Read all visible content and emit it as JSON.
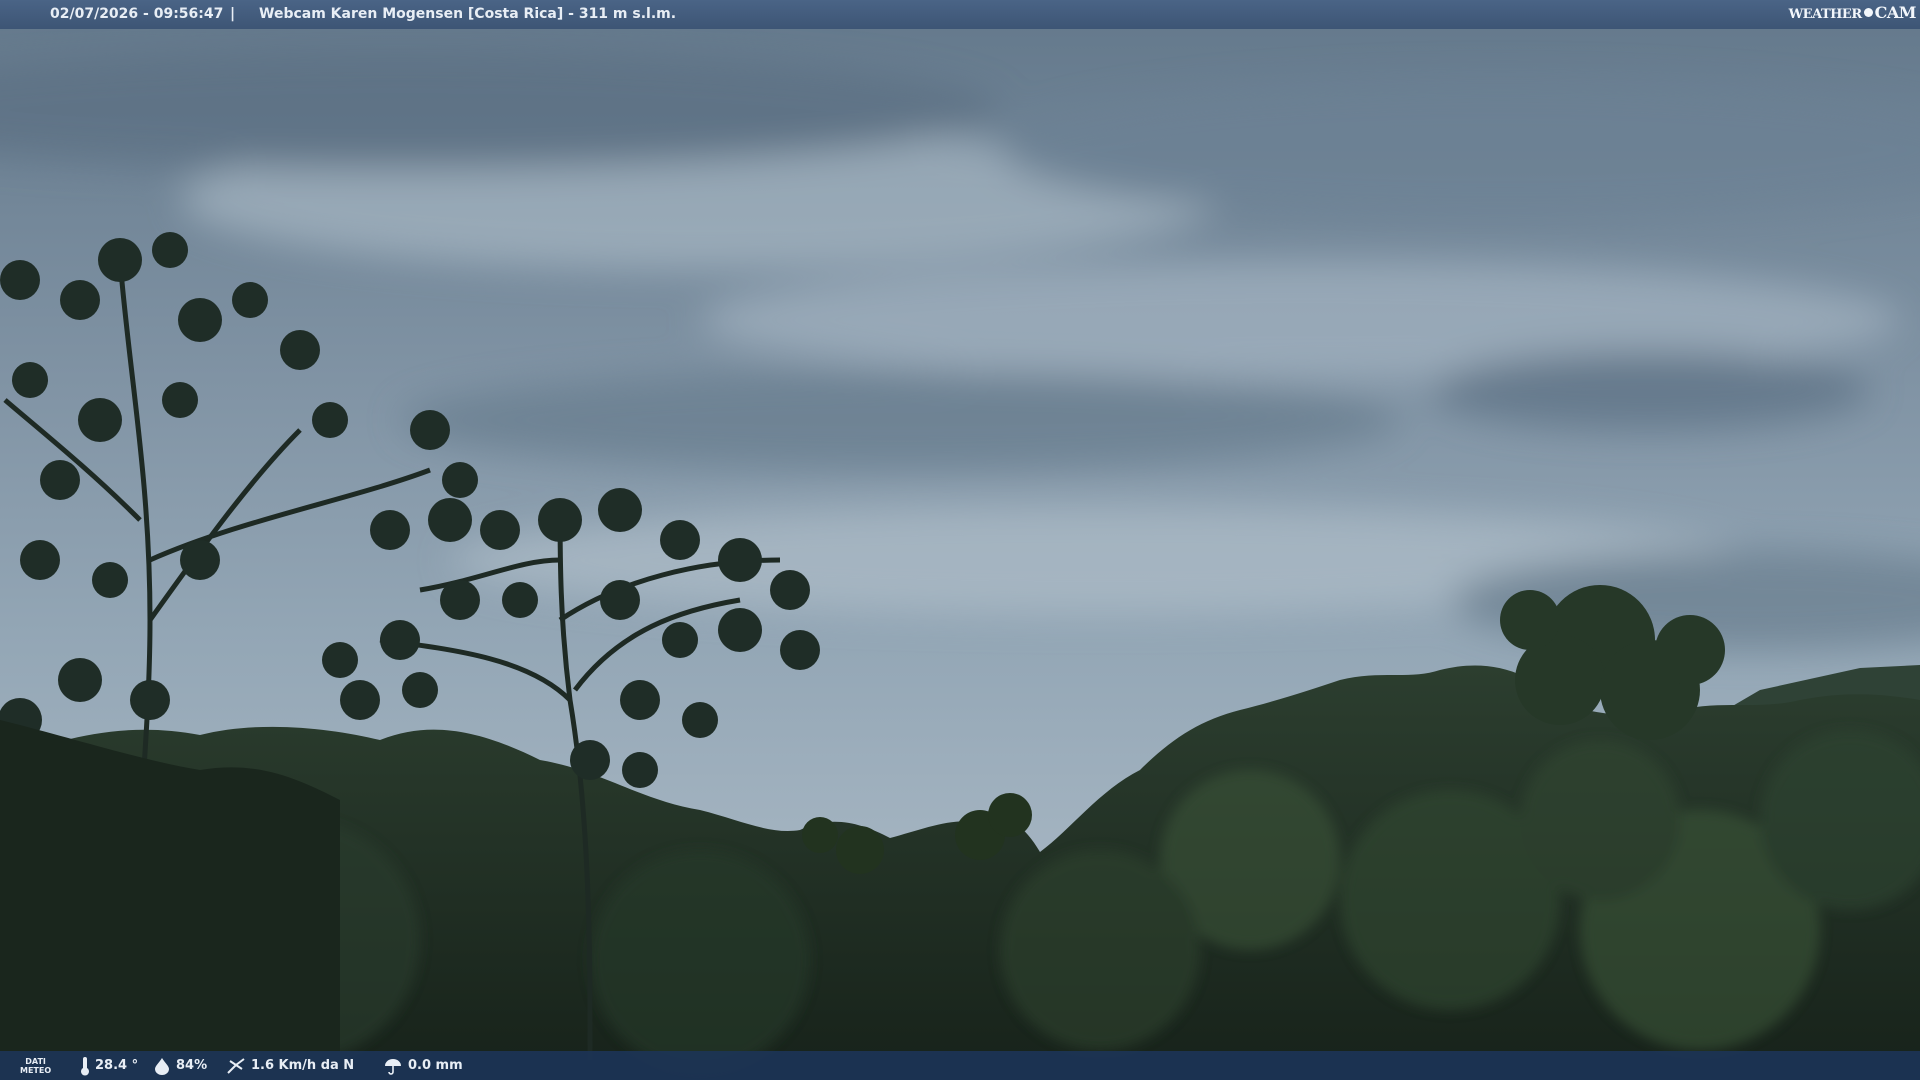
{
  "header": {
    "datetime": "02/07/2026 - 09:56:47",
    "separator": "|",
    "title": "Webcam Karen Mogensen [Costa Rica]  - 311 m s.l.m.",
    "brand_left": "WEATHER",
    "brand_right": "CAM"
  },
  "footer": {
    "dati_line1": "DATI",
    "dati_line2": "METEO",
    "temperature": "28.4 °",
    "humidity": "84%",
    "wind": "1.6 Km/h da N",
    "rain": "0.0 mm",
    "icons": [
      "thermometer-icon",
      "humidity-drop-icon",
      "wind-icon",
      "rain-umbrella-icon"
    ]
  },
  "colors": {
    "sky_top": "#6f8597",
    "sky_mid": "#8fa3b3",
    "sky_low": "#a8b8c4",
    "forest_dark": "#1e2c22",
    "forest_mid": "#2d4030",
    "bar_blue": "#3d5575"
  }
}
